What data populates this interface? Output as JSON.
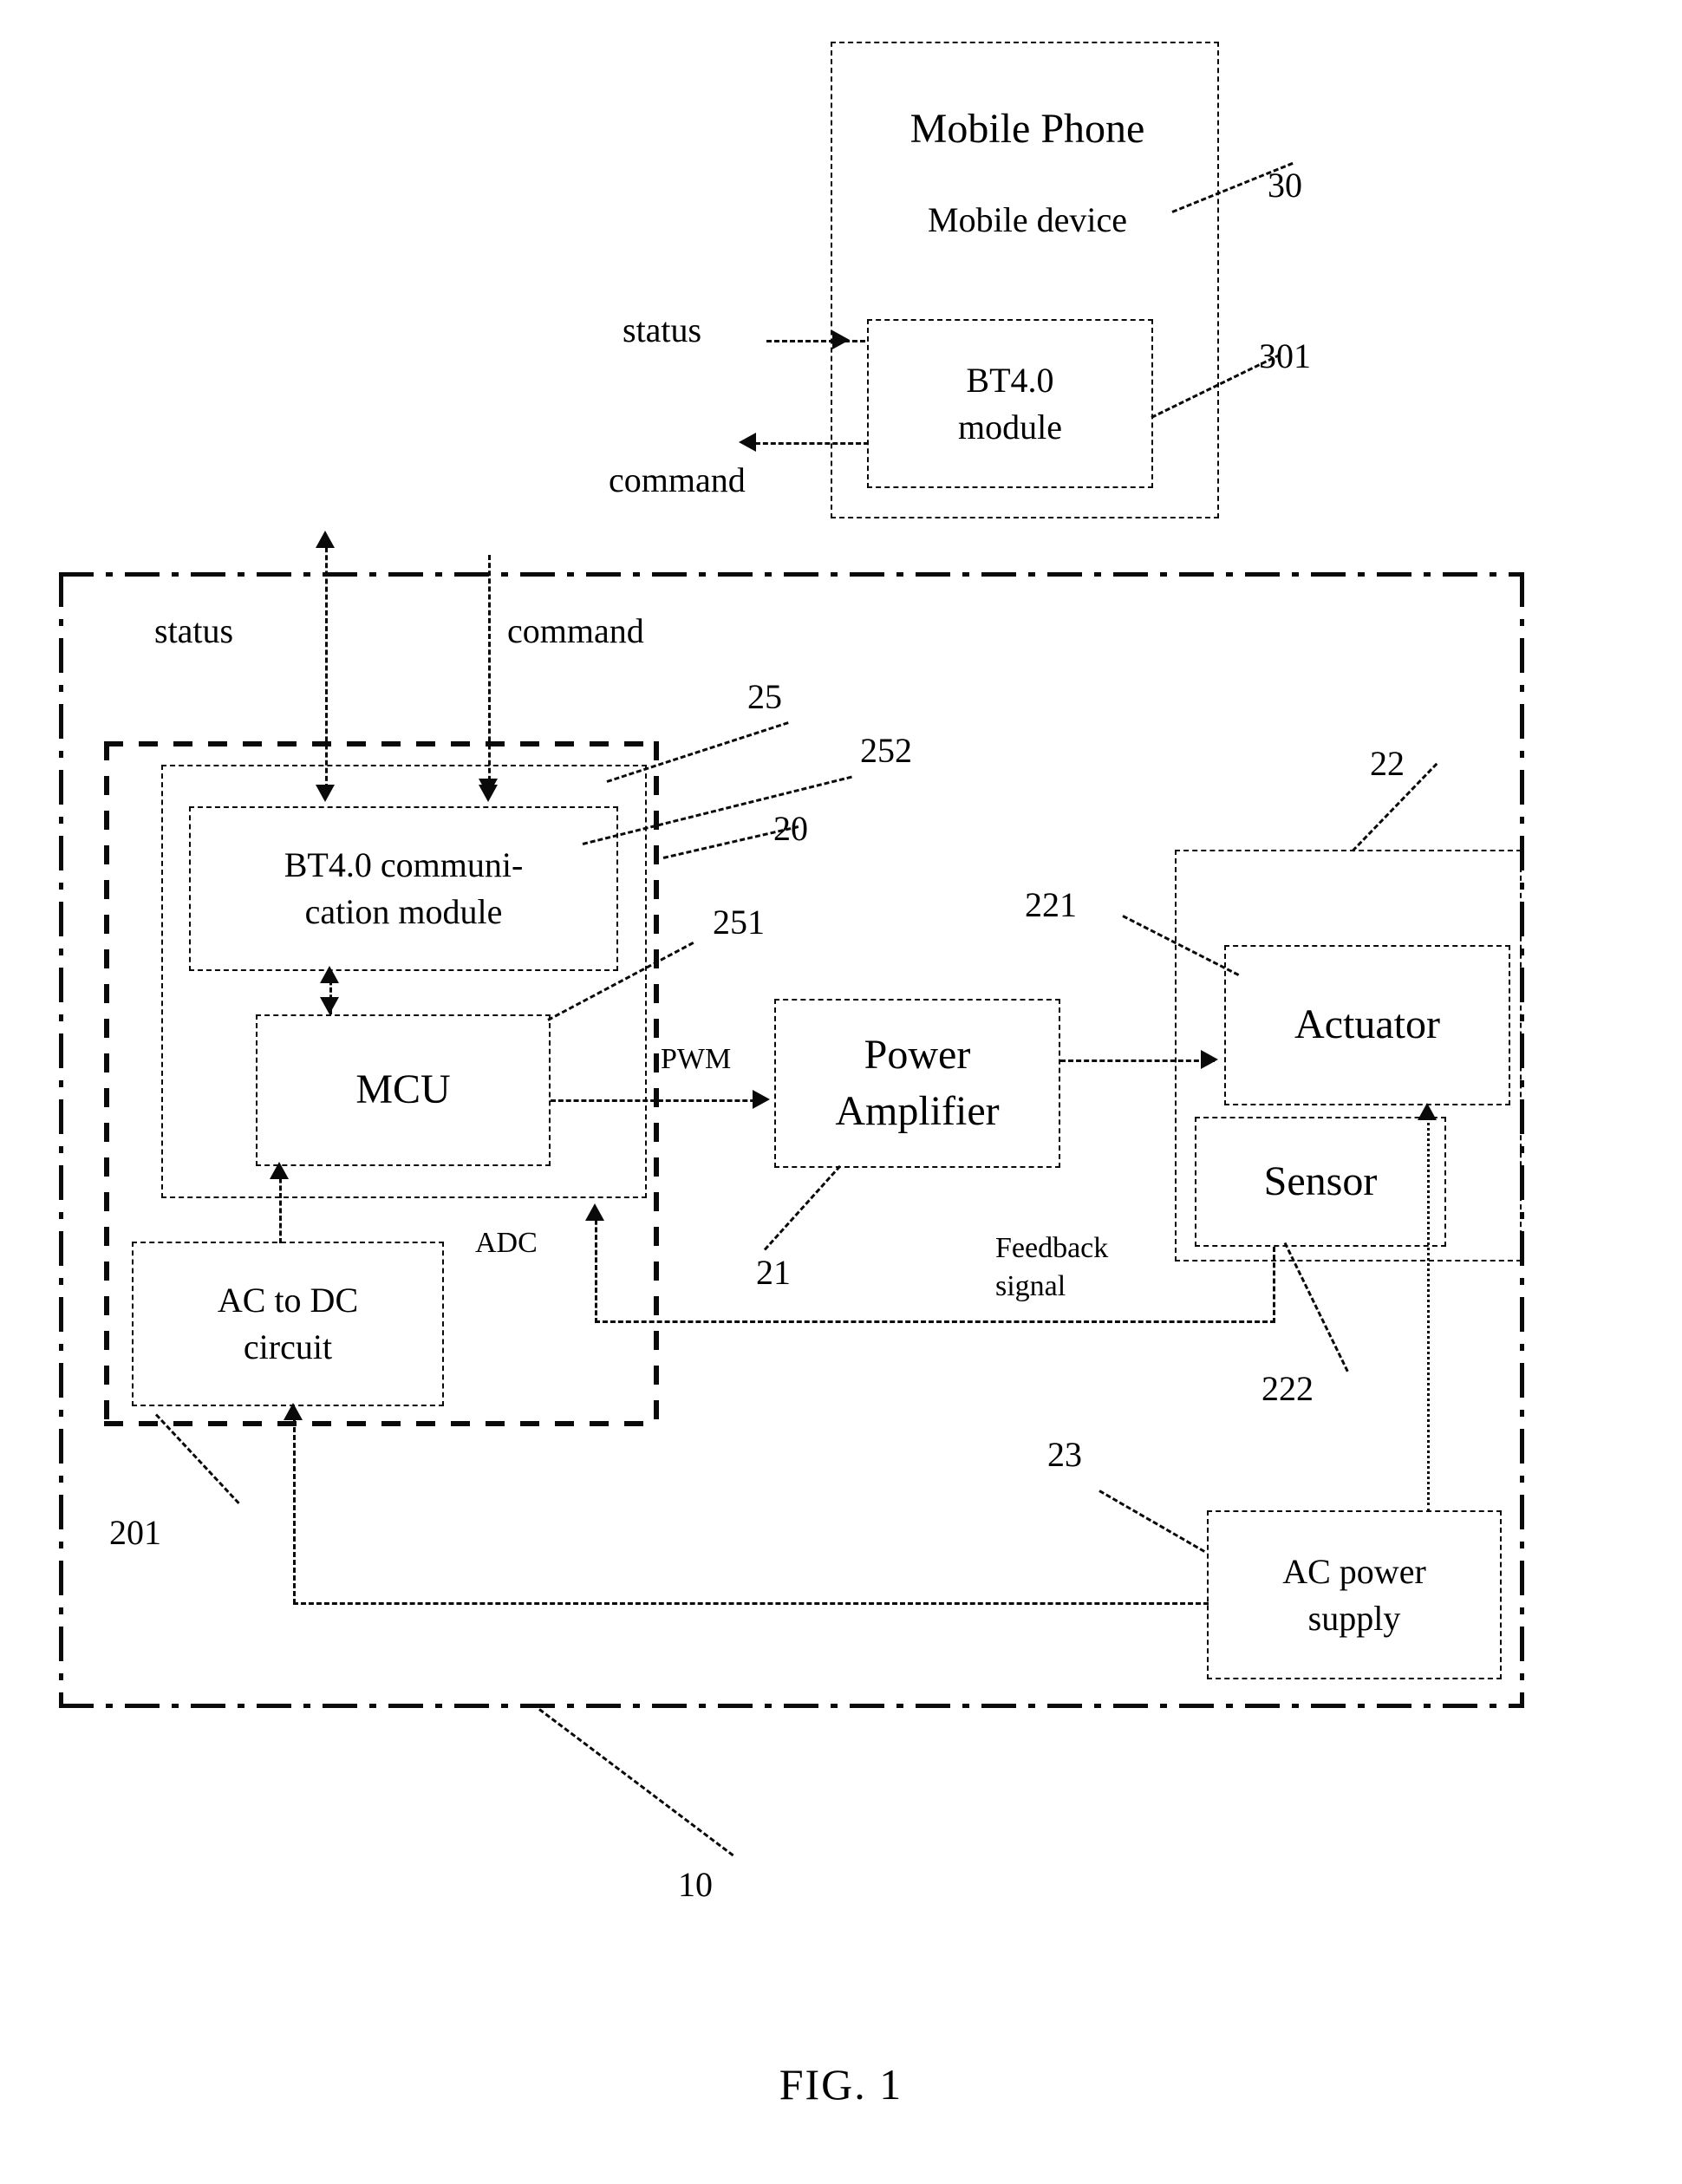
{
  "figure": {
    "caption": "FIG. 1",
    "title_hidden": ""
  },
  "mobile_device": {
    "title": "Mobile Phone",
    "subtitle": "Mobile device",
    "ref": "30",
    "bt_module": {
      "label": "BT4.0\nmodule",
      "ref": "301"
    },
    "signals": {
      "status": "status",
      "command": "command"
    }
  },
  "system": {
    "ref": "10",
    "signals": {
      "status": "status",
      "command": "command"
    },
    "control_unit": {
      "ref": "20",
      "ac_to_dc": {
        "label": "AC to DC\ncircuit",
        "ref": "201"
      },
      "controller_group": {
        "ref": "25",
        "bt_comm_module": {
          "label": "BT4.0 communi-\ncation module",
          "ref": "252"
        },
        "mcu": {
          "label": "MCU",
          "ref": "251"
        }
      }
    },
    "power_amplifier": {
      "label": "Power\nAmplifier",
      "ref": "21"
    },
    "actuator_group": {
      "ref": "22",
      "actuator": {
        "label": "Actuator",
        "ref": "221"
      },
      "sensor": {
        "label": "Sensor",
        "ref": "222"
      }
    },
    "ac_power_supply": {
      "label": "AC power\nsupply",
      "ref": "23"
    },
    "signal_labels": {
      "pwm": "PWM",
      "adc": "ADC",
      "feedback": "Feedback\nsignal"
    }
  },
  "colors": {
    "ink": "#0a0a0a",
    "paper": "#ffffff"
  }
}
